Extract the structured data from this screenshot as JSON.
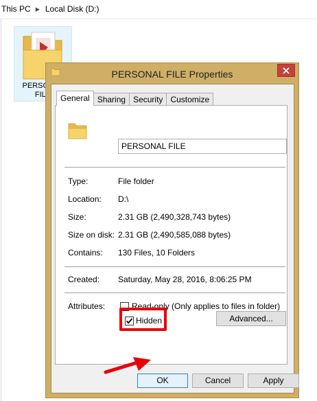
{
  "breadcrumb": {
    "items": [
      "This PC",
      "Local Disk (D:)"
    ]
  },
  "background_folder": {
    "label_line1": "PERSONAL",
    "label_line2": "FILE"
  },
  "dialog": {
    "title": "PERSONAL FILE Properties",
    "close_glyph": "✕",
    "tabs": [
      {
        "label": "General",
        "active": true
      },
      {
        "label": "Sharing",
        "active": false
      },
      {
        "label": "Security",
        "active": false
      },
      {
        "label": "Customize",
        "active": false
      }
    ],
    "folder_name": "PERSONAL FILE",
    "type": {
      "label": "Type:",
      "value": "File folder"
    },
    "location": {
      "label": "Location:",
      "value": "D:\\"
    },
    "size": {
      "label": "Size:",
      "value": "2.31 GB (2,490,328,743 bytes)"
    },
    "size_on_disk": {
      "label": "Size on disk:",
      "value": "2.31 GB (2,490,585,088 bytes)"
    },
    "contains": {
      "label": "Contains:",
      "value": "130 Files, 10 Folders"
    },
    "created": {
      "label": "Created:",
      "value": "Saturday, May 28, 2016, 8:06:25 PM"
    },
    "attributes": {
      "label": "Attributes:",
      "readonly": {
        "label": "Read-only (Only applies to files in folder)",
        "checked": false
      },
      "hidden": {
        "label": "Hidden",
        "checked": true
      },
      "advanced_label": "Advanced..."
    },
    "buttons": {
      "ok": "OK",
      "cancel": "Cancel",
      "apply": "Apply"
    }
  },
  "colors": {
    "dialog_frame": "#cfae66",
    "close_button": "#c7413b",
    "highlight": "#e8000b",
    "folder_yellow": "#f6d36b"
  },
  "icons": {
    "folder": "folder-icon",
    "close": "close-icon",
    "checkmark": "checkmark-icon",
    "arrow": "red-arrow-annotation"
  }
}
